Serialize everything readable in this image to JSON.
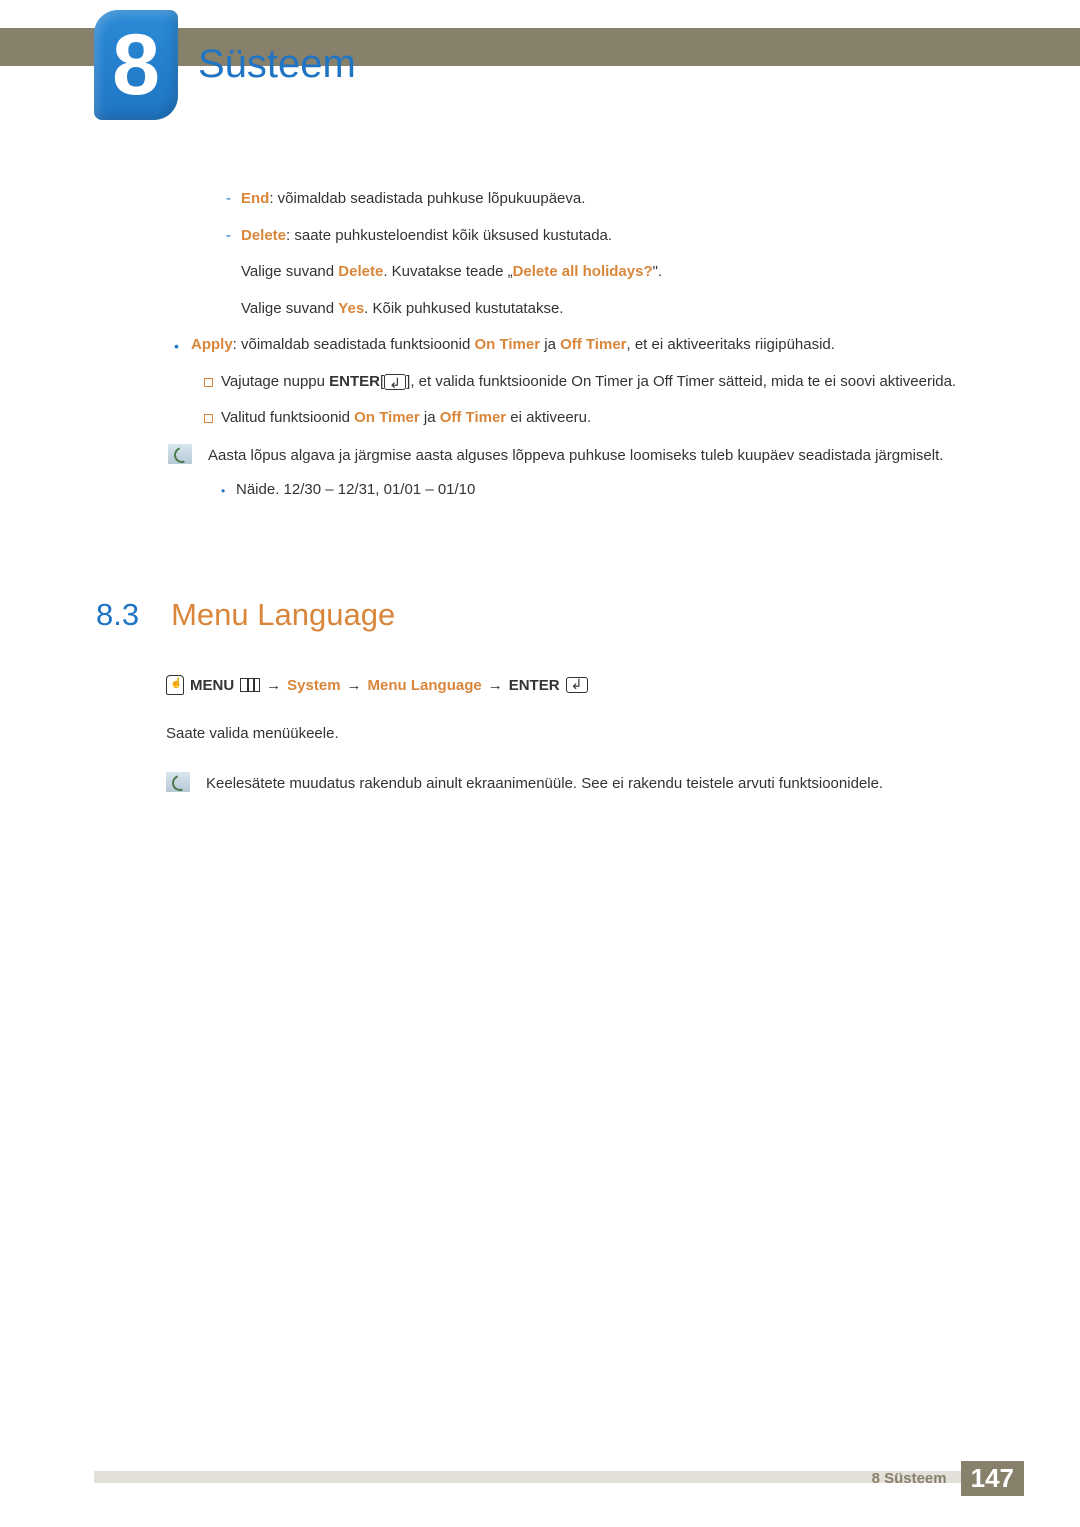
{
  "chapter": {
    "number": "8",
    "title": "Süsteem"
  },
  "body": {
    "end_label": "End",
    "end_text": ": võimaldab seadistada puhkuse lõpukuupäeva.",
    "delete_label": "Delete",
    "delete_text": ": saate puhkusteloendist kõik üksused kustutada.",
    "delete_line2_a": "Valige suvand ",
    "delete_line2_b": "Delete",
    "delete_line2_c": ". Kuvatakse teade „",
    "delete_line2_d": "Delete all holidays?",
    "delete_line2_e": "\".",
    "delete_line3_a": "Valige suvand ",
    "delete_line3_b": "Yes",
    "delete_line3_c": ". Kõik puhkused kustutatakse.",
    "apply_label": "Apply",
    "apply_text_a": ": võimaldab seadistada funktsioonid ",
    "apply_text_b": "On Timer",
    "apply_text_c": " ja ",
    "apply_text_d": "Off Timer",
    "apply_text_e": ", et ei aktiveeritaks riigipühasid.",
    "enter_a": "Vajutage nuppu ",
    "enter_b": "ENTER",
    "enter_c": "[",
    "enter_d": "], et valida funktsioonide On Timer ja Off Timer sätteid, mida te ei soovi aktiveerida.",
    "selected_a": "Valitud funktsioonid ",
    "selected_b": "On Timer",
    "selected_c": " ja ",
    "selected_d": "Off Timer",
    "selected_e": " ei aktiveeru.",
    "note1": "Aasta lõpus algava ja järgmise aasta alguses lõppeva puhkuse loomiseks tuleb kuupäev seadistada järgmiselt.",
    "example": "Näide. 12/30 – 12/31, 01/01 – 01/10"
  },
  "section": {
    "num": "8.3",
    "title": "Menu Language"
  },
  "menupath": {
    "menu": "MENU",
    "sys": "System",
    "ml": "Menu Language",
    "enter": "ENTER"
  },
  "plain": "Saate valida menüükeele.",
  "note2": "Keelesätete muudatus rakendub ainult ekraanimenüüle. See ei rakendu teistele arvuti funktsioonidele.",
  "footer": {
    "chapter": "8  Süsteem",
    "page": "147"
  }
}
